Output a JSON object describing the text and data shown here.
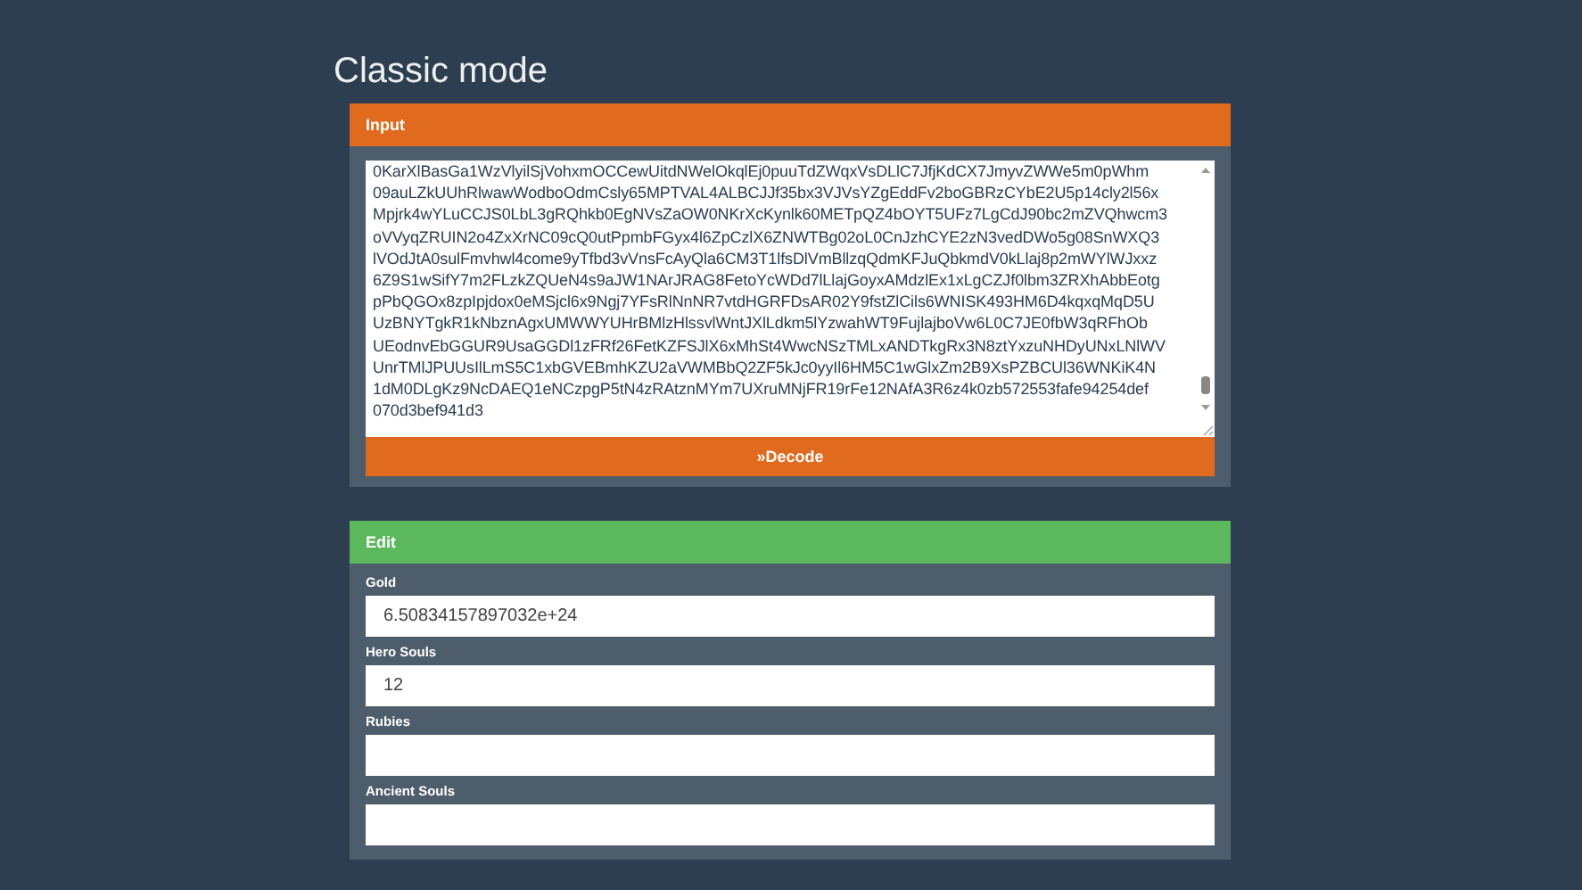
{
  "title": "Classic mode",
  "input_panel": {
    "header": "Input",
    "save_lines": [
      "0KarXlBasGa1WzVlyilSjVohxmOCCewUitdNWelOkqlEj0puuTdZWqxVsDLlC7JfjKdCX7JmyvZWWe5m0pWhm",
      "09auLZkUUhRlwawWodboOdmCsly65MPTVAL4ALBCJJf35bx3VJVsYZgEddFv2boGBRzCYbE2U5p14cly2l56x",
      "Mpjrk4wYLuCCJS0LbL3gRQhkb0EgNVsZaOW0NKrXcKynlk60METpQZ4bOYT5UFz7LgCdJ90bc2mZVQhwcm3",
      "oVVyqZRUIN2o4ZxXrNC09cQ0utPpmbFGyx4l6ZpCzlX6ZNWTBg02oL0CnJzhCYE2zN3vedDWo5g08SnWXQ3",
      "lVOdJtA0sulFmvhwl4come9yTfbd3vVnsFcAyQla6CM3T1lfsDlVmBllzqQdmKFJuQbkmdV0kLlaj8p2mWYlWJxxz",
      "6Z9S1wSifY7m2FLzkZQUeN4s9aJW1NArJRAG8FetoYcWDd7lLlajGoyxAMdzlEx1xLgCZJf0lbm3ZRXhAbbEotg",
      "pPbQGOx8zpIpjdox0eMSjcl6x9Ngj7YFsRlNnNR7vtdHGRFDsAR02Y9fstZlCils6WNISK493HM6D4kqxqMqD5U",
      "UzBNYTgkR1kNbznAgxUMWWYUHrBMlzHlssvlWntJXlLdkm5lYzwahWT9FujlajboVw6L0C7JE0fbW3qRFhOb",
      "UEodnvEbGGUR9UsaGGDl1zFRf26FetKZFSJlX6xMhSt4WwcNSzTMLxANDTkgRx3N8ztYxzuNHDyUNxLNlWV",
      "UnrTMlJPUUsIlLmS5C1xbGVEBmhKZU2aVWMBbQ2ZF5kJc0yyIl6HM5C1wGlxZm2B9XsPZBCUl36WNKiK4N",
      "1dM0DLgKz9NcDAEQ1eNCzpgP5tN4zRAtznMYm7UXruMNjFR19rFe12NAfA3R6z4k0zb572553fafe94254def",
      "070d3bef941d3"
    ],
    "button": "»Decode"
  },
  "edit_panel": {
    "header": "Edit",
    "fields": [
      {
        "label": "Gold",
        "value": "6.50834157897032e+24"
      },
      {
        "label": "Hero Souls",
        "value": "12"
      },
      {
        "label": "Rubies"
      },
      {
        "label": "Ancient Souls"
      }
    ]
  }
}
